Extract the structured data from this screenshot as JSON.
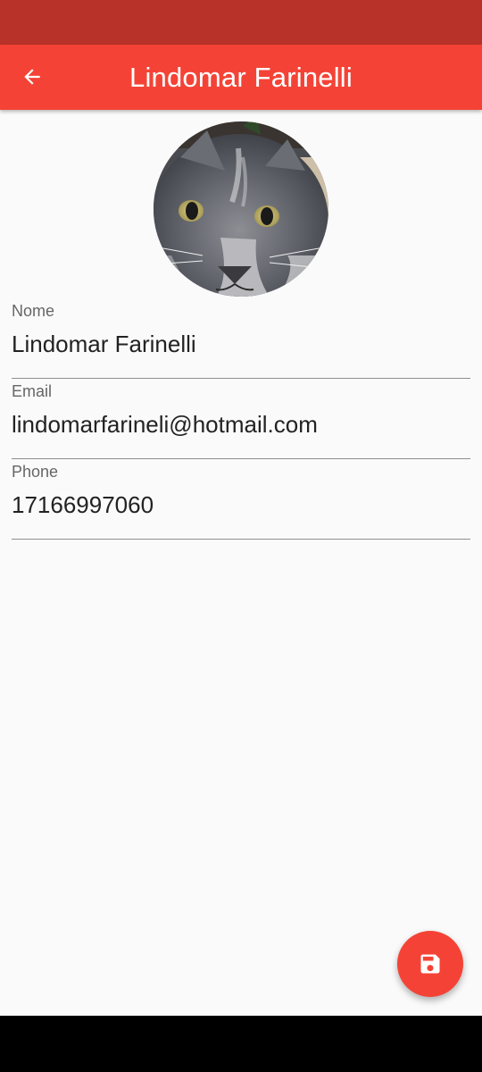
{
  "app_bar": {
    "title": "Lindomar Farinelli",
    "back_icon": "arrow-back-icon"
  },
  "colors": {
    "status_bar": "#b9322a",
    "primary": "#f44336",
    "background": "#fafafa"
  },
  "avatar": {
    "description_icon": "cat-photo"
  },
  "form": {
    "nome": {
      "label": "Nome",
      "value": "Lindomar Farinelli"
    },
    "email": {
      "label": "Email",
      "value": "lindomarfarineli@hotmail.com"
    },
    "phone": {
      "label": "Phone",
      "value": "17166997060"
    }
  },
  "fab": {
    "icon": "save-icon"
  }
}
